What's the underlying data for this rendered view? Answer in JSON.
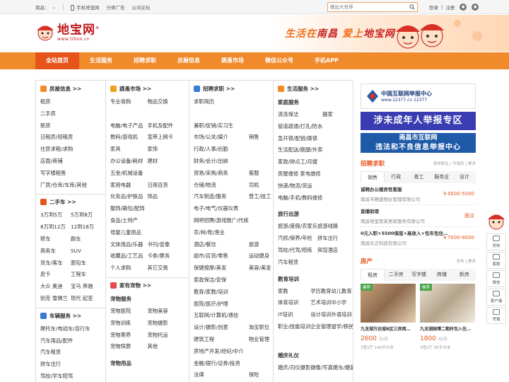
{
  "topbar": {
    "city": "南昌：",
    "city_arrow": "⌄",
    "mobile": "手机地宝网",
    "ads": "分类广告",
    "forum": "公共论坛",
    "search_placeholder": "搜出大世界",
    "login": "登录",
    "divider": "|",
    "register": "注册"
  },
  "logo": {
    "cn": "地宝网",
    "en": "www.tiboo.cn",
    "reg": "®"
  },
  "slogan": {
    "a": "生活在",
    "b": "南昌",
    "c": "  爱上",
    "d": "地宝网"
  },
  "nav": [
    "全站首页",
    "生活服务",
    "招聘求职",
    "房屋信息",
    "跳蚤市场",
    "微信公众号",
    "手机APP"
  ],
  "col1": {
    "title": "房屋信息 >>",
    "items": [
      "租房",
      "二手房",
      "新房",
      "日租房/短租房",
      "住房求租/求购",
      "店面/商铺",
      "写字楼租售",
      "厂房/仓库/车库/其他"
    ],
    "car_title": "二手车 >>",
    "car_items": [
      "3万到5万",
      "5万到8万",
      "8万到12万",
      "12到18万",
      "轿车",
      "跑车",
      "商务车",
      "SUV",
      "货车/客车",
      "面包车",
      "皮卡",
      "工程车",
      "大众 奥迪",
      "宝马 奔驰",
      "别克 雪佛兰",
      "现代 起亚"
    ],
    "svc_title": "车辆服务 >>",
    "svc_items": [
      "摩托车/电动车/自行车",
      "汽车用品/配件",
      "汽车租赁",
      "拼车出行",
      "驾校/学车陪驾"
    ]
  },
  "col2": {
    "title": "跳蚤市场 >>",
    "items": [
      "专业收购",
      "物品交换",
      "",
      "",
      "电脑/电子产品",
      "手机及配件",
      "数码/游戏机",
      "宽带上网卡",
      "家具",
      "家饰",
      "办公设备/耗材",
      "建材",
      "五金/机械设备",
      "",
      "家用电器",
      "日用百货",
      "化妆品/护肤品",
      "饰品",
      "服饰/箱包/配饰",
      "",
      "食品/土特产",
      "",
      "母婴儿童用品",
      "",
      "文体用品/乐器",
      "书刊/音像",
      "收藏品/工艺品",
      "卡券/票务",
      "个人求购",
      "其它交易"
    ],
    "pet_title": "家有宠物 >>",
    "pet_sub": "宠物服务",
    "pet_items": [
      "宠物医院",
      "宠物美容",
      "宠物训练",
      "宠物摄影",
      "宠物寄养",
      "宠物托运",
      "宠物殡葬",
      "其他"
    ],
    "pet_sub2": "宠物用品"
  },
  "col3": {
    "title": "招聘求职 >>",
    "items": [
      "求职简历",
      "",
      "",
      "",
      "兼职/促销/实习生",
      "",
      "市场/公关/媒介",
      "销售",
      "行政/人事/后勤",
      "",
      "财务/会计/出纳",
      "",
      "贸易/采购/商务",
      "客服",
      "仓储/物流",
      "司机",
      "汽车制造/服务",
      "普工/技工",
      "电子/电气/仪器仪表",
      "",
      "网吧招聘/游戏推广/代练",
      "",
      "农/林/牧/渔业",
      "",
      "酒店/餐饮",
      "旅游",
      "超市/百货/零售",
      "运动健身",
      "保健按摩/美发",
      "美容/美发",
      "家政保洁/安保",
      "",
      "教育/家教/培训",
      "",
      "医院/医疗/护理",
      "",
      "互联网/计算机/通信",
      "",
      "设计/摄影/创意",
      "淘宝职位",
      "建筑工程",
      "物业管理",
      "房地产开发/经纪/中介",
      "",
      "金融/银行/证券/投资",
      "",
      "法律",
      "保险"
    ]
  },
  "col4": {
    "title": "生活服务 >>",
    "house_sub": "家庭服务",
    "house_items": [
      "清洗保洁",
      "搬家",
      "管道疏通/打孔/防水",
      "",
      "急开锁/配钥/换锁",
      "",
      "生活配送/跑腿/外卖",
      "",
      "家政/钟点工/月嫂",
      "",
      "房屋维修 家电维修",
      "",
      "快递/物流/货运",
      "",
      "电脑/手机/数码维修",
      ""
    ],
    "travel_sub": "旅行出游",
    "travel_items": [
      "旅游/度假/农家乐",
      "旅游线路",
      "汽修/保养/年检",
      "拼车出行",
      "驾校/代驾/陪练",
      "宾馆酒店",
      "汽车租赁",
      ""
    ],
    "edu_sub": "教育培训",
    "edu_items": [
      "家教",
      "学历教育",
      "幼儿教育",
      "体育培训",
      "艺术培训",
      "中小学",
      "IT培训",
      "设计培训",
      "外语培训",
      "职业/技能培训",
      "企业管理",
      "留学/移民/签证",
      ""
    ],
    "wed_sub": "婚庆礼仪",
    "wed_items": [
      "婚庆/司仪",
      "摄影摄像/写真",
      "婚车/婚宴/婚纱"
    ]
  },
  "right": {
    "b1_t1": "中国互联网举报中心",
    "b1_t2": "www.12377.cn  12377",
    "b2": "涉未成年人举报专区",
    "b3_a": "南昌市互联网",
    "b3_b": "违法和不良信息举报中心",
    "jobs_title": "招聘求职",
    "jobs_more": "发布职位 | 写简历 | 更多",
    "jobs_tabs": [
      "销售",
      "行政",
      "普工",
      "服务业",
      "设计"
    ],
    "jobs": [
      {
        "title": "诚聘办公楼男性客服",
        "salary": "￥4500-5000",
        "company": "南昌市赛盛物业管理有限公司"
      },
      {
        "title": "直播助理",
        "salary": "面议",
        "company": "南昌地宝管家居家服务有限公司"
      },
      {
        "title": "0元入职+5500保底+高收入+包车包住…",
        "salary": "￥7000-9000",
        "company": "南昌乐正科技有限公司"
      }
    ],
    "house_title": "房产",
    "house_more": "发布 | 更多",
    "house_tabs": [
      "租房",
      "二手房",
      "写字楼",
      "商铺",
      "新房"
    ],
    "houses": [
      {
        "tag": "推荐",
        "title": "九龙湖万达城B区三房两…",
        "price": "2600",
        "unit": "元/月",
        "spec": "3室2厅 140平方米"
      },
      {
        "tag": "推荐",
        "title": "九龙湖国博二期拎包入住…",
        "price": "1800",
        "unit": "元/月",
        "spec": "3室2厅 95平方米"
      }
    ]
  },
  "float": [
    "发帖",
    "客服",
    "微信",
    "客户端",
    "举报"
  ]
}
